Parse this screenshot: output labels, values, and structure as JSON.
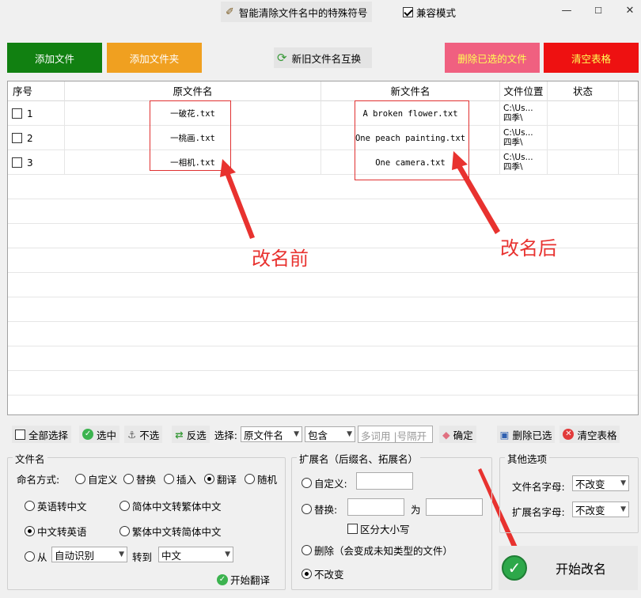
{
  "window": {
    "title": "智能清除文件名中的特殊符号",
    "compat_label": "兼容模式",
    "compat_checked": true,
    "minimize_symbol": "—",
    "maximize_symbol": "☐",
    "close_symbol": "✕"
  },
  "top_buttons": {
    "add_file": "添加文件",
    "add_folder": "添加文件夹",
    "swap_names": "新旧文件名互换",
    "delete_selected": "删除已选的文件",
    "clear_table": "清空表格"
  },
  "colors": {
    "add_file": "#118011",
    "add_folder": "#f0a020",
    "delete_selected": "#f06080",
    "clear_table": "#ee1111",
    "annotation": "#e8322f"
  },
  "table": {
    "headers": [
      "序号",
      "原文件名",
      "新文件名",
      "文件位置",
      "状态"
    ],
    "rows": [
      {
        "index": "1",
        "original": "一破花.txt",
        "new": "A broken flower.txt",
        "location_1": "C:\\Us...",
        "location_2": "四季\\",
        "status": ""
      },
      {
        "index": "2",
        "original": "一桃画.txt",
        "new": "One peach painting.txt",
        "location_1": "C:\\Us...",
        "location_2": "四季\\",
        "status": ""
      },
      {
        "index": "3",
        "original": "一相机.txt",
        "new": "One camera.txt",
        "location_1": "C:\\Us...",
        "location_2": "四季\\",
        "status": ""
      }
    ]
  },
  "annotations": {
    "before": "改名前",
    "after": "改名后"
  },
  "toolbar": {
    "select_all": "全部选择",
    "select": "选中",
    "deselect": "不选",
    "invert": "反选",
    "choose_label": "选择:",
    "field_value": "原文件名",
    "match_value": "包含",
    "keywords_placeholder": "多词用 |号隔开",
    "confirm": "确定",
    "delete_selected": "删除已选",
    "clear_table": "清空表格"
  },
  "filename_group": {
    "title": "文件名",
    "mode_label": "命名方式:",
    "modes": [
      "自定义",
      "替换",
      "插入",
      "翻译",
      "随机"
    ],
    "mode_selected": "翻译",
    "options": [
      "英语转中文",
      "简体中文转繁体中文",
      "中文转英语",
      "繁体中文转简体中文"
    ],
    "option_selected": "中文转英语",
    "from_label": "从",
    "from_value": "自动识别",
    "to_label": "转到",
    "to_value": "中文",
    "start_translate": "开始翻译"
  },
  "extension_group": {
    "title": "扩展名（后缀名、拓展名）",
    "custom": "自定义:",
    "replace": "替换:",
    "for_label": "为",
    "case_sensitive": "区分大小写",
    "delete": "删除（会变成未知类型的文件）",
    "unchanged": "不改变",
    "selected": "不改变"
  },
  "other_group": {
    "title": "其他选项",
    "filename_case_label": "文件名字母:",
    "filename_case_value": "不改变",
    "ext_case_label": "扩展名字母:",
    "ext_case_value": "不改变"
  },
  "start_button": {
    "label": "开始改名",
    "check_symbol": "✓"
  }
}
